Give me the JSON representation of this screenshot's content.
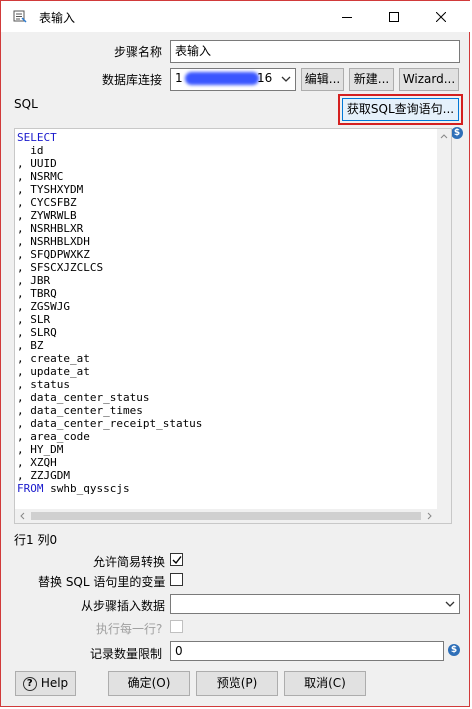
{
  "window": {
    "title": "表输入",
    "icons": {
      "app": "table-input-icon",
      "minimize": "minimize-icon",
      "maximize": "maximize-icon",
      "close": "close-icon"
    }
  },
  "form": {
    "step_name_label": "步骤名称",
    "step_name_value": "表输入",
    "db_conn_label": "数据库连接",
    "db_conn_value_start": "1",
    "db_conn_value_end": "16",
    "edit_button": "编辑...",
    "new_button": "新建...",
    "wizard_button": "Wizard...",
    "sql_label": "SQL",
    "get_sql_button": "获取SQL查询语句..."
  },
  "sql": {
    "lines": [
      "SELECT",
      "  id",
      ", UUID",
      ", NSRMC",
      ", TYSHXYDM",
      ", CYCSFBZ",
      ", ZYWRWLB",
      ", NSRHBLXR",
      ", NSRHBLXDH",
      ", SFQDPWXKZ",
      ", SFSCXJZCLCS",
      ", JBR",
      ", TBRQ",
      ", ZGSWJG",
      ", SLR",
      ", SLRQ",
      ", BZ",
      ", create_at",
      ", update_at",
      ", status",
      ", data_center_status",
      ", data_center_times",
      ", data_center_receipt_status",
      ", area_code",
      ", HY_DM",
      ", XZQH",
      ", ZZJGDM",
      "FROM swhb_qysscjs"
    ],
    "keywords": [
      "SELECT",
      "FROM"
    ]
  },
  "status": {
    "position": "行1 列0"
  },
  "options": {
    "lazy_conversion_label": "允许简易转换",
    "lazy_conversion_checked": true,
    "replace_vars_label": "替换 SQL 语句里的变量",
    "replace_vars_checked": false,
    "insert_from_step_label": "从步骤插入数据",
    "insert_from_step_value": "",
    "execute_each_row_label": "执行每一行?",
    "execute_each_row_checked": false,
    "limit_label": "记录数量限制",
    "limit_value": "0"
  },
  "buttons": {
    "help": "Help",
    "ok": "确定(O)",
    "preview": "预览(P)",
    "cancel": "取消(C)"
  },
  "colors": {
    "keyword": "#1a1acc",
    "highlight": "#d42020",
    "window_border": "#d13a3a",
    "variable_badge": "#2e6fb8"
  }
}
